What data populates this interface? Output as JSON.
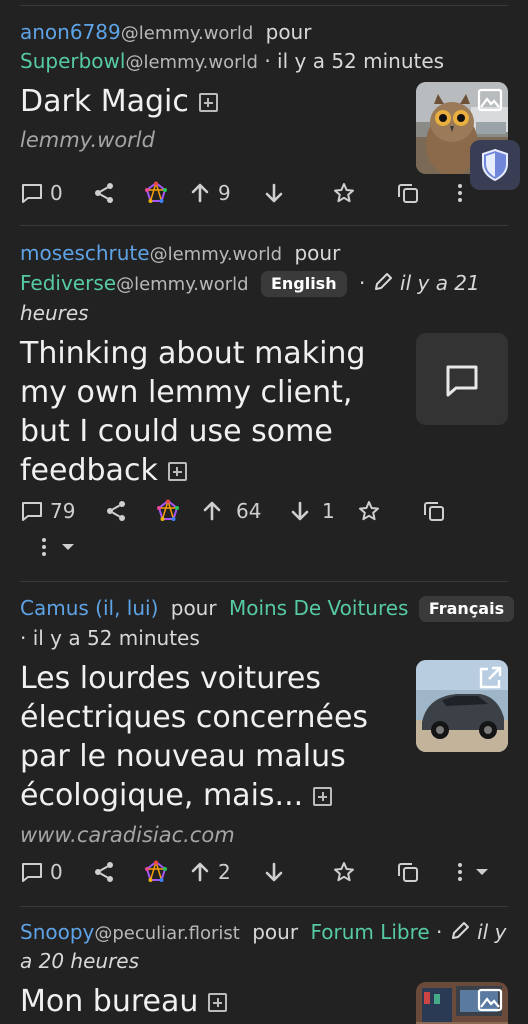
{
  "posts": [
    {
      "user": "anon6789",
      "user_instance": "@lemmy.world",
      "pour": "pour",
      "community": "Superbowl",
      "community_instance": "@lemmy.world",
      "time": " · il y a 52 minutes",
      "title": "Dark Magic",
      "domain": "lemmy.world",
      "comments": "0",
      "upvotes": "9",
      "thumb_icon": "image-icon"
    },
    {
      "user": "moseschrute",
      "user_instance": "@lemmy.world",
      "pour": "pour",
      "community": "Fediverse",
      "community_instance": "@lemmy.world",
      "language": "English",
      "time_line1": "il y a 21",
      "time_line2": "heures",
      "title_lines": [
        "Thinking about making",
        "my own lemmy client,",
        "but I could use some",
        "feedback"
      ],
      "comments": "79",
      "upvotes": "64",
      "downvotes": "1",
      "thumb_icon": "comment-icon"
    },
    {
      "user": "Camus (il, lui)",
      "pour": "pour",
      "community": "Moins De Voitures",
      "language": "Français",
      "time": "· il y a 52 minutes",
      "title_lines": [
        "Les lourdes voitures",
        "électriques concernées",
        "par le nouveau malus",
        "écologique, mais..."
      ],
      "domain": "www.caradisiac.com",
      "comments": "0",
      "upvotes": "2",
      "thumb_icon": "external-link-icon"
    },
    {
      "user": "Snoopy",
      "user_instance": "@peculiar.florist",
      "pour": "pour",
      "community": "Forum Libre",
      "time_line1": "il y",
      "time_line2": "a 20 heures",
      "title": "Mon bureau",
      "thumb_icon": "image-icon"
    }
  ],
  "colors": {
    "background": "#222222",
    "user": "#5ea3e6",
    "community": "#56c9a5"
  },
  "floating_button_icon": "shield-icon"
}
